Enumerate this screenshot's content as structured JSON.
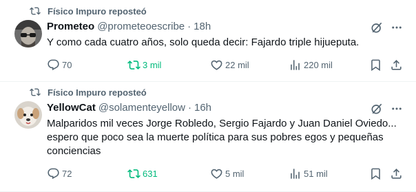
{
  "tweets": [
    {
      "repost_label": "Físico Impuro reposteó",
      "author_name": "Prometeo",
      "handle": "@prometeoescribe",
      "dot": "·",
      "time": "18h",
      "text": "Y como cada cuatro años, solo queda decir: Fajardo triple hijueputa.",
      "replies": "70",
      "reposts": "3 mil",
      "likes": "22 mil",
      "views": "220 mil",
      "reposted": true,
      "avatar_icon": "man-with-glasses-avatar"
    },
    {
      "repost_label": "Físico Impuro reposteó",
      "author_name": "YellowCat",
      "handle": "@solamenteyellow",
      "dot": "·",
      "time": "16h",
      "text_lines": [
        "Malparidos mil veces Jorge Robledo, Sergio Fajardo y Juan Daniel Oviedo...",
        "espero que poco sea la muerte política para sus pobres egos y pequeñas",
        "conciencias"
      ],
      "replies": "72",
      "reposts": "631",
      "likes": "5 mil",
      "views": "51 mil",
      "reposted": true,
      "avatar_icon": "dog-avatar"
    }
  ],
  "colors": {
    "text_primary": "#0f1419",
    "text_secondary": "#536471",
    "reposted_green": "#00ba7c",
    "divider": "#eff3f4"
  },
  "icons": {
    "repost": "repost-icon",
    "reply": "reply-icon",
    "like": "heart-icon",
    "views": "views-icon",
    "bookmark": "bookmark-icon",
    "share": "share-icon",
    "grok": "grok-icon",
    "more": "more-icon"
  }
}
